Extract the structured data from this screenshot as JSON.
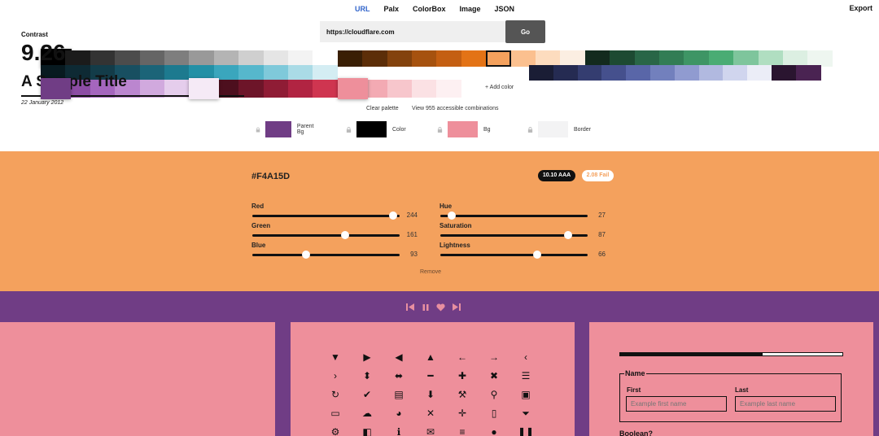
{
  "nav": {
    "tabs": [
      "URL",
      "Palx",
      "ColorBox",
      "Image",
      "JSON"
    ],
    "active_tab": "URL",
    "export_label": "Export"
  },
  "url_bar": {
    "value": "https://cloudflare.com",
    "go_label": "Go"
  },
  "palette": {
    "rows": [
      [
        "#000000",
        "#1b1b1b",
        "#333333",
        "#4c4c4c",
        "#656565",
        "#7e7e7e",
        "#999999",
        "#b4b4b4",
        "#cfcfcf",
        "#e5e5e5",
        "#f3f3f3",
        "#ffffff",
        "#3a1f05",
        "#5c2e08",
        "#83420d",
        "#a6520f",
        "#c45f12",
        "#e37316",
        "#F4A15D",
        "#fbc08f",
        "#fddcbe",
        "#fbeee2",
        "#132a1e",
        "#1d4a32",
        "#296647",
        "#327d55",
        "#3e9565",
        "#4aac74",
        "#7ec59c",
        "#b0dec1",
        "#dcefe2",
        "#eef6f0"
      ],
      [
        "#081a20",
        "#0e2a34",
        "#133c49",
        "#184f61",
        "#1b6478",
        "#1d7a8f",
        "#2390a6",
        "#3aa6bd",
        "#56b7cc",
        "#7fc9da",
        "#aadbe6",
        "#d4edf3",
        "#1a1d35",
        "#252b52",
        "#343d70",
        "#45508d",
        "#5966a8",
        "#7280bd",
        "#909bd0",
        "#b1b9e0",
        "#d0d5ee",
        "#ebedf7",
        "#2a1530",
        "#4a2352"
      ],
      [
        "#703D85",
        "#8c4ca4",
        "#a566be",
        "#bb86cf",
        "#d1a9de",
        "#e5cdec",
        "#f5eaf6",
        "#4d0f1e",
        "#6d1529",
        "#8f1c35",
        "#b12442",
        "#cf3550",
        "#EE8F9B",
        "#f3aab3",
        "#f7c6cc",
        "#fbe1e4",
        "#fdf0f2"
      ]
    ],
    "add_color_label": "+ Add color",
    "clear_label": "Clear palette",
    "combos_label": "View 955 accessible combinations"
  },
  "roles": [
    {
      "label": "Parent Bg",
      "color": "#703D85"
    },
    {
      "label": "Color",
      "color": "#000000"
    },
    {
      "label": "Bg",
      "color": "#EE8F9B"
    },
    {
      "label": "Border",
      "color": "#f3f3f4"
    }
  ],
  "editor": {
    "hex": "#F4A15D",
    "badge_aaa": "10.10 AAA",
    "badge_fail": "2.08 Fail",
    "rgb": [
      {
        "label": "Red",
        "value": "244",
        "max": 255
      },
      {
        "label": "Green",
        "value": "161",
        "max": 255
      },
      {
        "label": "Blue",
        "value": "93",
        "max": 255
      }
    ],
    "hsl": [
      {
        "label": "Hue",
        "value": "27",
        "max": 360
      },
      {
        "label": "Saturation",
        "value": "87",
        "max": 100
      },
      {
        "label": "Lightness",
        "value": "66",
        "max": 100
      }
    ],
    "remove_label": "Remove"
  },
  "controls": [
    "skip-back-icon",
    "pause-icon",
    "heart-icon",
    "skip-forward-icon"
  ],
  "preview": {
    "contrast_label": "Contrast",
    "contrast_value": "9.26",
    "sample_title": "A Sample Title",
    "sample_date": "22 January 2012",
    "icons": [
      {
        "n": "caret-down-icon",
        "g": "▼"
      },
      {
        "n": "caret-right-icon",
        "g": "▶"
      },
      {
        "n": "caret-left-icon",
        "g": "◀"
      },
      {
        "n": "caret-up-icon",
        "g": "▲"
      },
      {
        "n": "arrow-left-icon",
        "g": "←"
      },
      {
        "n": "arrow-right-icon",
        "g": "→"
      },
      {
        "n": "chevron-left-icon",
        "g": "‹"
      },
      {
        "n": "chevron-right-icon",
        "g": "›"
      },
      {
        "n": "expand-vertical-icon",
        "g": "⬍"
      },
      {
        "n": "expand-horizontal-icon",
        "g": "⬌"
      },
      {
        "n": "minus-icon",
        "g": "━"
      },
      {
        "n": "plus-icon",
        "g": "✚"
      },
      {
        "n": "close-icon",
        "g": "✖"
      },
      {
        "n": "menu-icon",
        "g": "☰"
      },
      {
        "n": "refresh-icon",
        "g": "↻"
      },
      {
        "n": "check-icon",
        "g": "✔"
      },
      {
        "n": "calendar-icon",
        "g": "▤"
      },
      {
        "n": "download-icon",
        "g": "⬇"
      },
      {
        "n": "wrench-icon",
        "g": "⚒"
      },
      {
        "n": "location-icon",
        "g": "⚲"
      },
      {
        "n": "chat-icon",
        "g": "▣"
      },
      {
        "n": "card-icon",
        "g": "▭"
      },
      {
        "n": "cloud-upload-icon",
        "g": "☁"
      },
      {
        "n": "pie-chart-icon",
        "g": "◕"
      },
      {
        "n": "shrink-icon",
        "g": "✕"
      },
      {
        "n": "expand-icon",
        "g": "✛"
      },
      {
        "n": "document-icon",
        "g": "▯"
      },
      {
        "n": "filter-icon",
        "g": "⏷"
      },
      {
        "n": "settings-icon",
        "g": "⚙"
      },
      {
        "n": "bookmark-icon",
        "g": "◧"
      },
      {
        "n": "info-icon",
        "g": "ℹ"
      },
      {
        "n": "mail-icon",
        "g": "✉"
      },
      {
        "n": "list-icon",
        "g": "≡"
      },
      {
        "n": "check-circle-icon",
        "g": "●"
      },
      {
        "n": "pause-icon",
        "g": "❚❚"
      }
    ],
    "progress": 0.64,
    "name_legend": "Name",
    "first_label": "First",
    "last_label": "Last",
    "first_placeholder": "Example first name",
    "last_placeholder": "Example last name",
    "boolean_label": "Boolean?"
  }
}
